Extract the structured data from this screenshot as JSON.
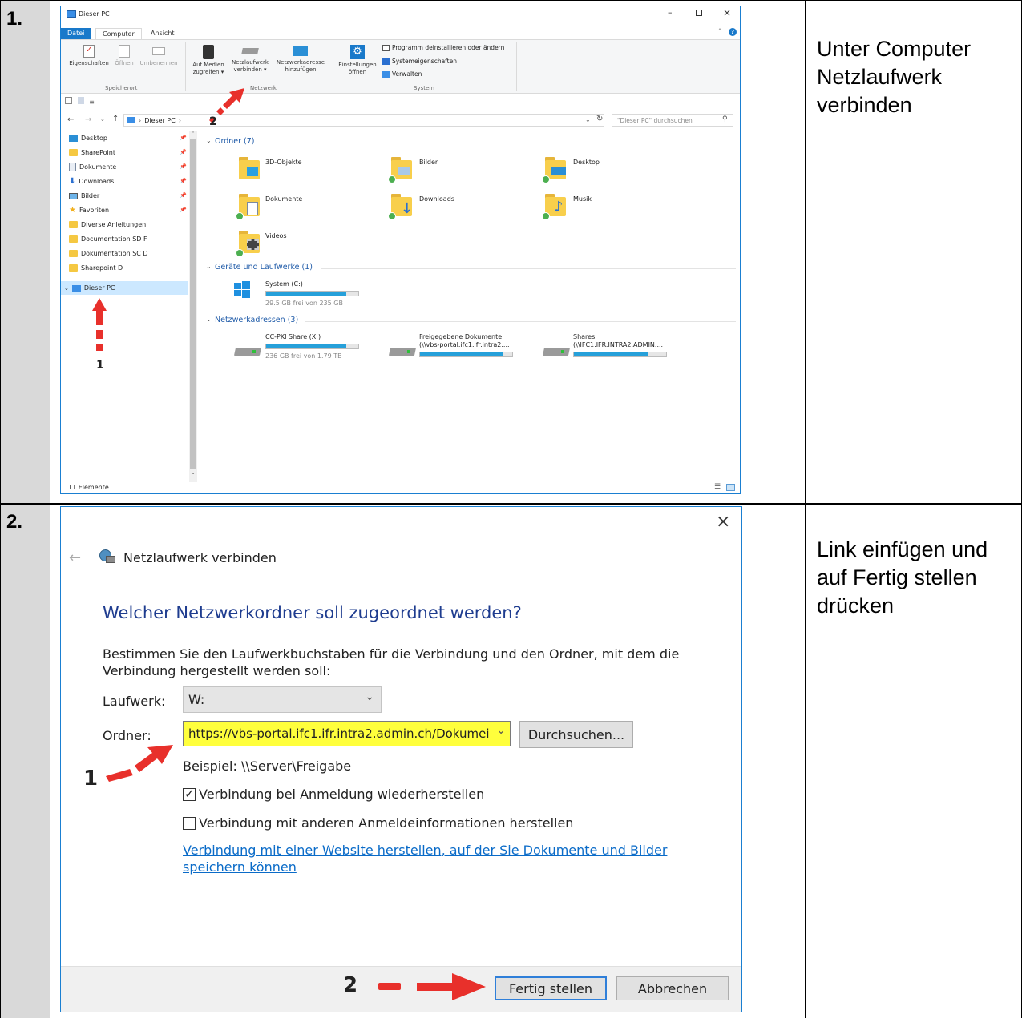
{
  "steps": [
    {
      "number": "1.",
      "description": "Unter Computer Netzlaufwerk verbinden"
    },
    {
      "number": "2.",
      "description": "Link einfügen und auf Fertig stellen drücken"
    }
  ],
  "explorer": {
    "title": "Dieser PC",
    "tabs": [
      "Datei",
      "Computer",
      "Ansicht"
    ],
    "ribbon": {
      "eigenschaften": "Eigenschaften",
      "oeffnen": "Öffnen",
      "umbenennen": "Umbenennen",
      "group_speicherort": "Speicherort",
      "auf_medien_1": "Auf Medien",
      "auf_medien_2": "zugreifen ▾",
      "netzlaufwerk_1": "Netzlaufwerk",
      "netzlaufwerk_2": "verbinden ▾",
      "netzwerkadresse_1": "Netzwerkadresse",
      "netzwerkadresse_2": "hinzufügen",
      "group_netzwerk": "Netzwerk",
      "einstellungen_1": "Einstellungen",
      "einstellungen_2": "öffnen",
      "programm": "Programm deinstallieren oder ändern",
      "systemeigenschaften": "Systemeigenschaften",
      "verwalten": "Verwalten",
      "group_system": "System"
    },
    "address": "Dieser PC",
    "search_placeholder": "\"Dieser PC\" durchsuchen",
    "nav": [
      "Desktop",
      "SharePoint",
      "Dokumente",
      "Downloads",
      "Bilder",
      "Favoriten",
      "Diverse Anleitungen",
      "Documentation SD F",
      "Dokumentation SC D",
      "Sharepoint D"
    ],
    "nav_selected": "Dieser PC",
    "section_folders": "Ordner (7)",
    "folders": [
      "3D-Objekte",
      "Bilder",
      "Desktop",
      "Dokumente",
      "Downloads",
      "Musik",
      "Videos"
    ],
    "section_drives": "Geräte und Laufwerke (1)",
    "drive": {
      "name": "System (C:)",
      "free": "29.5 GB frei von 235 GB",
      "used_fraction": 0.87
    },
    "section_network": "Netzwerkadressen (3)",
    "network": [
      {
        "name": "CC-PKI Share (X:)",
        "sub": "236 GB frei von 1.79 TB",
        "used_fraction": 0.87
      },
      {
        "name": "Freigegebene Dokumente",
        "sub": "(\\\\vbs-portal.ifc1.ifr.intra2....",
        "used_fraction": 0.9
      },
      {
        "name": "Shares",
        "sub": "(\\\\IFC1.IFR.INTRA2.ADMIN....",
        "used_fraction": 0.8
      }
    ],
    "status": "11 Elemente",
    "annotation_1": "1",
    "annotation_2": "2"
  },
  "dialog": {
    "title": "Netzlaufwerk verbinden",
    "heading": "Welcher Netzwerkordner soll zugeordnet werden?",
    "instruction": "Bestimmen Sie den Laufwerkbuchstaben für die Verbindung und den Ordner, mit dem die Verbindung hergestellt werden soll:",
    "laufwerk_label": "Laufwerk:",
    "laufwerk_value": "W:",
    "ordner_label": "Ordner:",
    "ordner_value": "https://vbs-portal.ifc1.ifr.intra2.admin.ch/Dokumei",
    "browse": "Durchsuchen...",
    "beispiel": "Beispiel: \\\\Server\\Freigabe",
    "check1": "Verbindung bei Anmeldung wiederherstellen",
    "check1_checked": true,
    "check2": "Verbindung mit anderen Anmeldeinformationen herstellen",
    "check2_checked": false,
    "link": "Verbindung mit einer Website herstellen, auf der Sie Dokumente und Bilder speichern können",
    "finish": "Fertig stellen",
    "cancel": "Abbrechen",
    "annotation_1": "1",
    "annotation_2": "2"
  }
}
